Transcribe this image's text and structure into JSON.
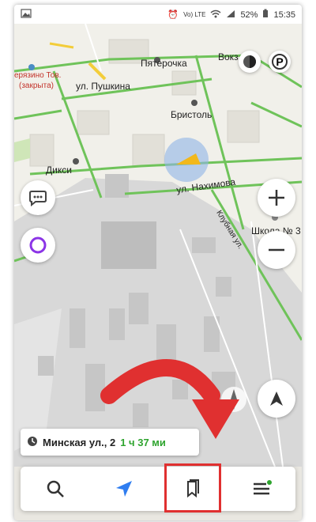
{
  "status": {
    "battery": "52%",
    "time": "15:35",
    "network": "Vo) LTE"
  },
  "map": {
    "places": {
      "pyaterochka": "Пятерочка",
      "vokzal": "Вокз",
      "pushkina": "ул. Пушкина",
      "store_closed_line1": "ерязино Тов.",
      "store_closed_line2": "(закрыта)",
      "bristol": "Бристоль",
      "diksi": "Дикси",
      "nakhimova": "ул. Нахимова",
      "school": "Школа № 3",
      "klubnaya": "Клубная ул."
    }
  },
  "route": {
    "address": "Минская ул., 2",
    "duration": "1 ч 37 ми"
  },
  "buttons": {
    "parking_label": "P"
  },
  "tabs": [
    "search",
    "navigator",
    "bookmarks",
    "menu"
  ],
  "colors": {
    "accent": "#2f7df0",
    "alice": "#8b34e6",
    "highlight": "#e03030",
    "arrow": "#e03030",
    "route_time": "#2ea42e"
  }
}
